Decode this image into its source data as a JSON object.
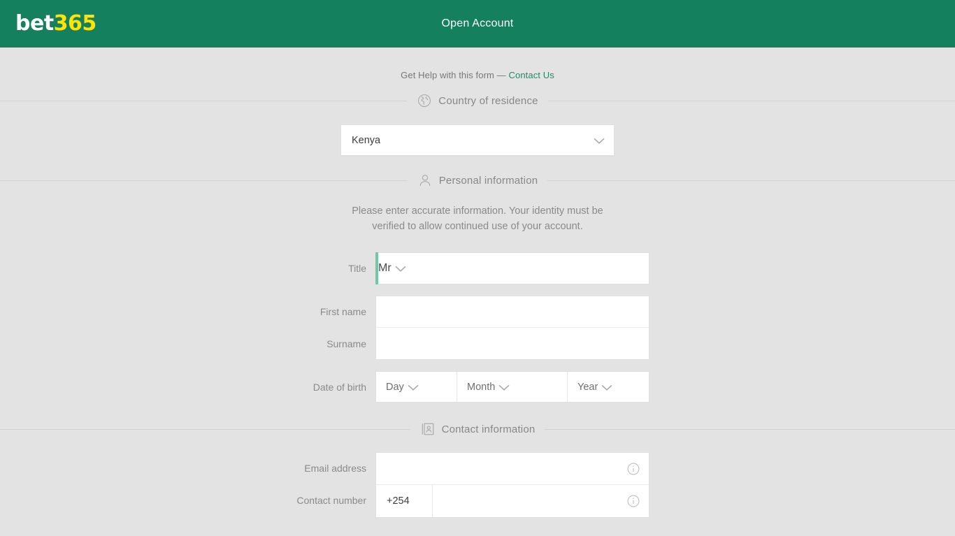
{
  "brand": {
    "logo_primary": "bet",
    "logo_secondary": "365",
    "header_color": "#14805e",
    "accent_color": "#6fc9a7",
    "link_color": "#1a8f63",
    "page_background": "#e3e3e3"
  },
  "header": {
    "title": "Open Account"
  },
  "help": {
    "text": "Get Help with this form —",
    "link_label": "Contact Us"
  },
  "sections": {
    "country": {
      "icon": "globe-icon",
      "label": "Country of residence"
    },
    "personal": {
      "icon": "user-icon",
      "label": "Personal information"
    },
    "contact": {
      "icon": "address-book-icon",
      "label": "Contact information"
    }
  },
  "country": {
    "selected": "Kenya",
    "chevron": "chevron-down-icon"
  },
  "personal": {
    "blurb": "Please enter accurate information. Your identity must be verified to allow continued use of your account.",
    "title_label": "Title",
    "title_value": "Mr",
    "first_name_label": "First name",
    "first_name_value": "",
    "first_name_placeholder": "",
    "surname_label": "Surname",
    "surname_value": "",
    "surname_placeholder": "",
    "dob_label": "Date of birth",
    "dob_day": "Day",
    "dob_month": "Month",
    "dob_year": "Year"
  },
  "contact": {
    "email_label": "Email address",
    "email_value": "",
    "email_placeholder": "",
    "email_info_icon": "info-icon",
    "phone_label": "Contact number",
    "phone_dial_code": "+254",
    "phone_value": "",
    "phone_placeholder": "",
    "phone_info_icon": "info-icon"
  }
}
